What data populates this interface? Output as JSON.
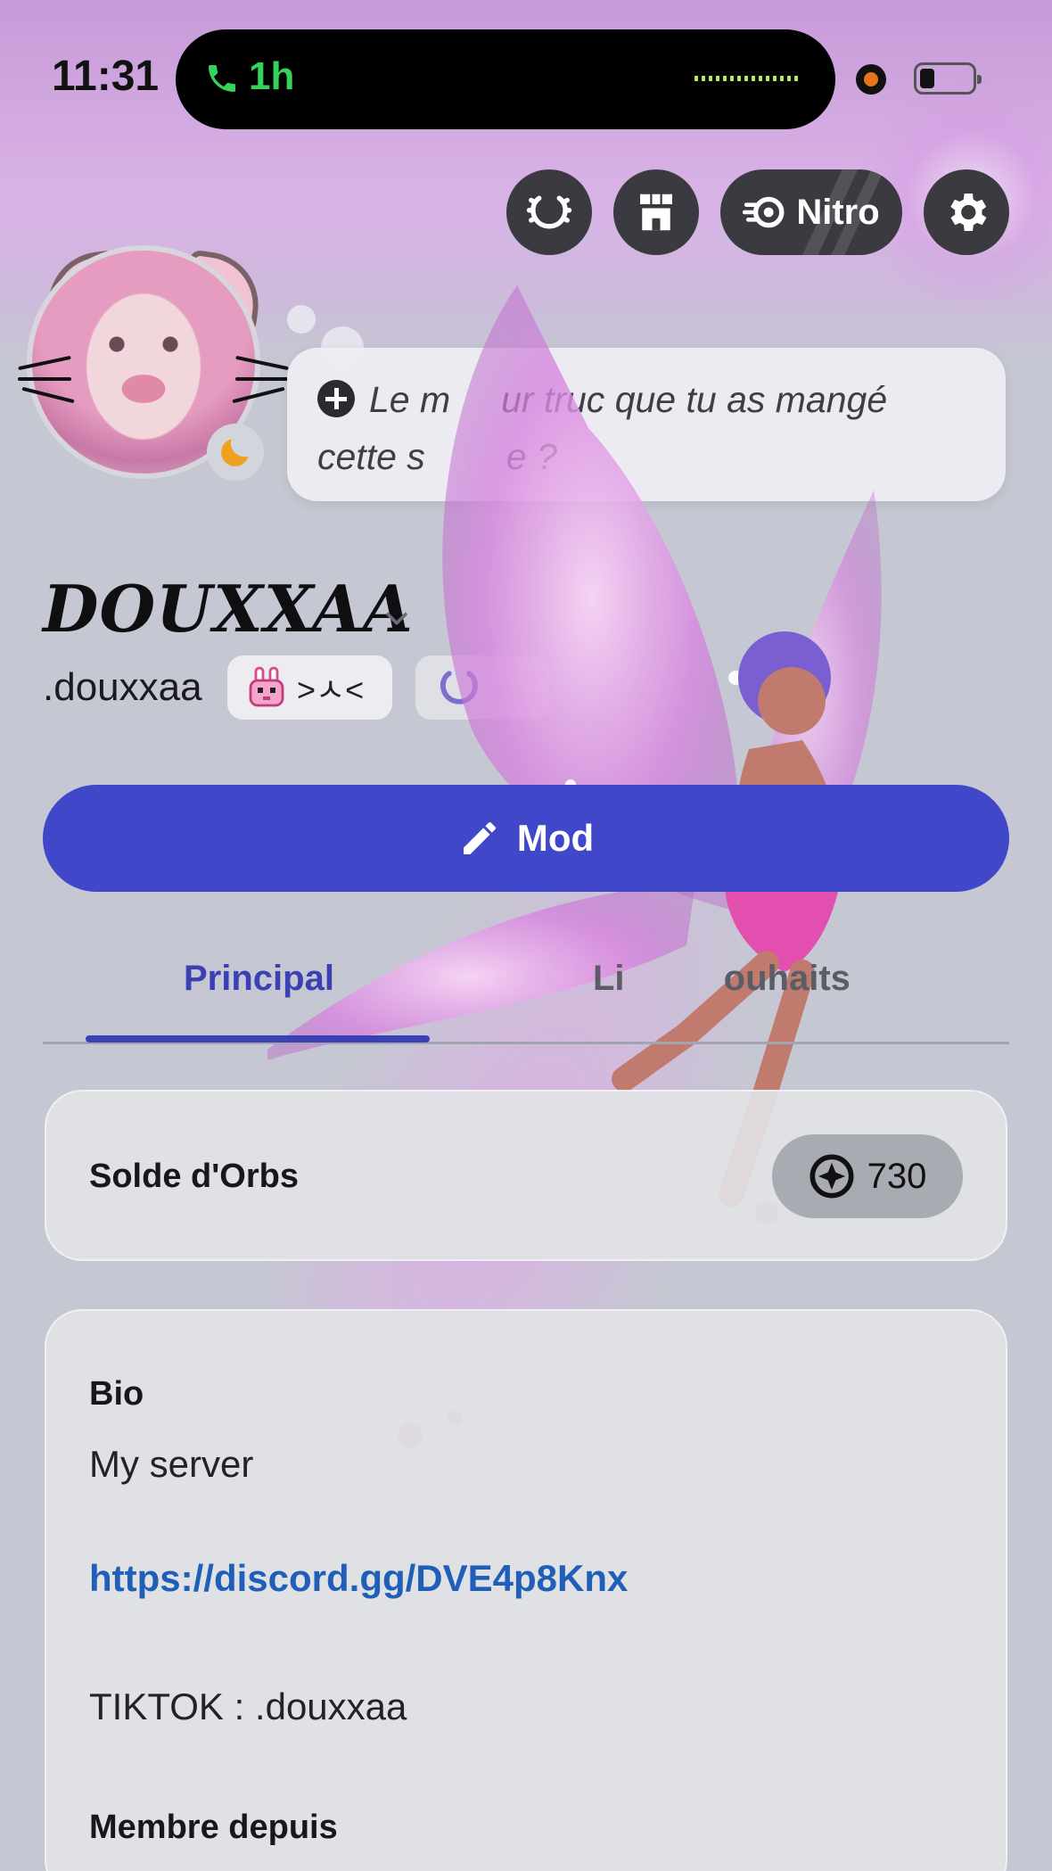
{
  "status_bar": {
    "time": "11:31",
    "call_duration": "1h",
    "call_icon": "phone-icon",
    "battery_icon": "battery-icon",
    "recording_color": "#e7741b"
  },
  "header_actions": [
    {
      "name": "orbs-wreath-button",
      "icon": "laurel-icon"
    },
    {
      "name": "shop-button",
      "icon": "storefront-icon"
    },
    {
      "name": "nitro-button",
      "icon": "nitro-icon",
      "label": "Nitro"
    },
    {
      "name": "settings-button",
      "icon": "gear-icon"
    }
  ],
  "nitro_label": "Nitro",
  "status_bubble": {
    "placeholder": "Le meilleur truc que tu as mangé cette semaine ?",
    "visible_line1": "Le m     ur truc que tu as mangé",
    "visible_line2": "cette s        e ?"
  },
  "profile": {
    "display_name": "DOUXXAA",
    "username": ".douxxaa",
    "tag_text": ">ㅅ<",
    "tag_icon": "bunny-icon",
    "presence": "idle"
  },
  "edit_button": {
    "label": "Modifier le profil",
    "visible_label": "Mod",
    "icon": "pencil-icon"
  },
  "tabs": [
    {
      "label": "Principal",
      "active": true
    },
    {
      "label": "Liste de souhaits",
      "visible_label": "Li          ouhaits",
      "active": false
    }
  ],
  "orbs": {
    "label": "Solde d'Orbs",
    "value": "730",
    "icon": "orb-icon"
  },
  "bio": {
    "label": "Bio",
    "line1": "My server",
    "link": "https://discord.gg/DVE4p8Knx",
    "line3": "TIKTOK : .douxxaa"
  },
  "member_since": {
    "label": "Membre depuis"
  },
  "colors": {
    "accent": "#4047c9",
    "tab_active": "#3b41b5",
    "link": "#1f5fb8",
    "banner": "#c79ad8"
  }
}
